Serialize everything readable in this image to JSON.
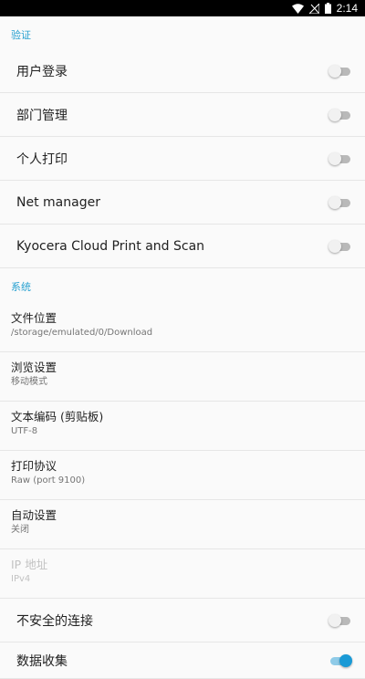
{
  "status_bar": {
    "time": "2:14",
    "icons": [
      "wifi-icon",
      "no-signal-icon",
      "battery-icon"
    ]
  },
  "colors": {
    "accent": "#26a0d0",
    "switch_on": "#1a9ad6",
    "switch_off": "#b9b9b9",
    "divider": "#e6e6e6",
    "background": "#fafafa"
  },
  "sections": {
    "auth": {
      "header": "验证",
      "items": [
        {
          "label": "用户登录",
          "on": false
        },
        {
          "label": "部门管理",
          "on": false
        },
        {
          "label": "个人打印",
          "on": false
        },
        {
          "label": "Net manager",
          "on": false
        },
        {
          "label": "Kyocera Cloud Print and Scan",
          "on": false
        }
      ]
    },
    "system": {
      "header": "系统",
      "items": [
        {
          "title": "文件位置",
          "summary": "/storage/emulated/0/Download",
          "enabled": true
        },
        {
          "title": "浏览设置",
          "summary": "移动模式",
          "enabled": true
        },
        {
          "title": "文本编码 (剪贴板)",
          "summary": "UTF-8",
          "enabled": true
        },
        {
          "title": "打印协议",
          "summary": "Raw (port 9100)",
          "enabled": true
        },
        {
          "title": "自动设置",
          "summary": "关闭",
          "enabled": true
        },
        {
          "title": "IP 地址",
          "summary": "IPv4",
          "enabled": false
        }
      ],
      "switches": [
        {
          "label": "不安全的连接",
          "on": false
        },
        {
          "label": "数据收集",
          "on": true
        }
      ]
    }
  }
}
